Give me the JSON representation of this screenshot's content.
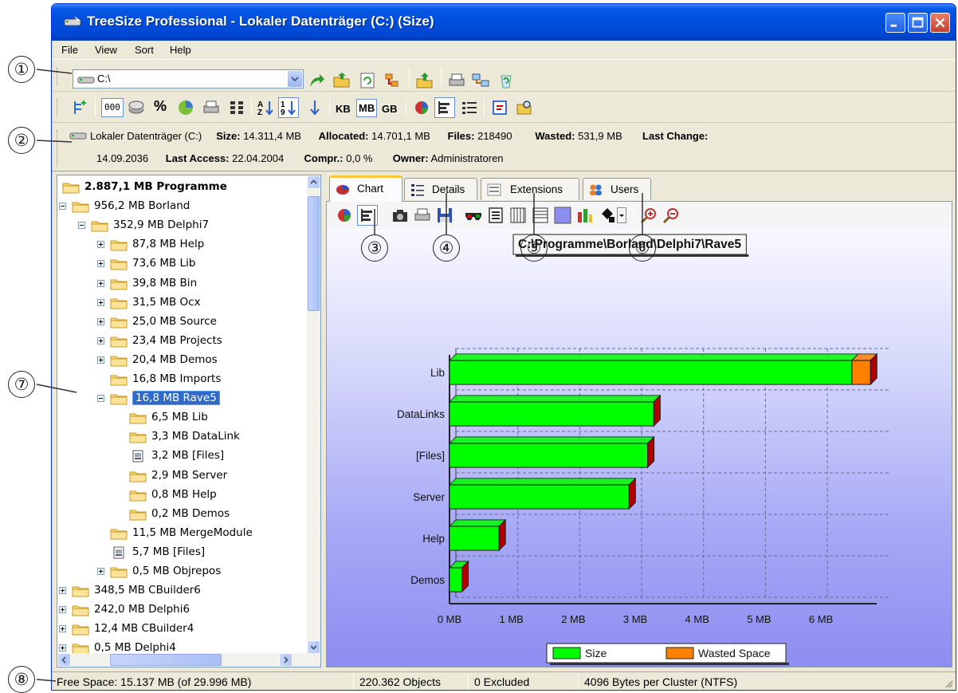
{
  "window": {
    "title": "TreeSize Professional - Lokaler Datenträger (C:)  (Size)",
    "controls": [
      "minimize",
      "maximize",
      "close"
    ]
  },
  "menu": [
    "File",
    "View",
    "Sort",
    "Help"
  ],
  "toolbar1": {
    "path_value": "C:\\",
    "icons": [
      "go-arrow-icon",
      "open-folder-icon",
      "refresh-icon",
      "scan-icon",
      "export-icon",
      "print-icon",
      "network-icon",
      "recycle-icon"
    ]
  },
  "toolbar2": {
    "icons": [
      "add-tree-icon",
      "size-mode-icon",
      "disk-icon",
      "percent-icon",
      "pie-mode-icon",
      "printer-icon",
      "grid-icon",
      "sort-az-icon",
      "sort-size-icon",
      "sort-down-icon",
      "pie-chart-icon",
      "bar-chart-icon",
      "list-icon",
      "report-icon",
      "search-icon"
    ],
    "size_box": "000",
    "percent": "%",
    "units": [
      "KB",
      "MB",
      "GB"
    ]
  },
  "info": {
    "drive": "Lokaler Datenträger (C:)",
    "size_label": "Size:",
    "size_value": "14.311,4 MB",
    "allocated_label": "Allocated:",
    "allocated_value": "14.701,1 MB",
    "files_label": "Files:",
    "files_value": "218490",
    "wasted_label": "Wasted:",
    "wasted_value": "531,9 MB",
    "lastchange_label": "Last Change:",
    "lastchange_value": "14.09.2036",
    "lastaccess_label": "Last Access:",
    "lastaccess_value": "22.04.2004",
    "compr_label": "Compr.:",
    "compr_value": "0,0 %",
    "owner_label": "Owner:",
    "owner_value": "Administratoren"
  },
  "tree": {
    "root": "2.887,1 MB Programme",
    "items": [
      {
        "text": "956,2 MB Borland"
      },
      {
        "text": "352,9 MB Delphi7"
      },
      {
        "text": "87,8 MB Help"
      },
      {
        "text": "73,6 MB Lib"
      },
      {
        "text": "39,8 MB Bin"
      },
      {
        "text": "31,5 MB Ocx"
      },
      {
        "text": "25,0 MB Source"
      },
      {
        "text": "23,4 MB Projects"
      },
      {
        "text": "20,4 MB Demos"
      },
      {
        "text": "16,8 MB Imports"
      },
      {
        "text": "16,8 MB Rave5"
      },
      {
        "text": "6,5 MB Lib"
      },
      {
        "text": "3,3 MB DataLink"
      },
      {
        "text": "3,2 MB [Files]"
      },
      {
        "text": "2,9 MB Server"
      },
      {
        "text": "0,8 MB Help"
      },
      {
        "text": "0,2 MB Demos"
      },
      {
        "text": "11,5 MB MergeModule"
      },
      {
        "text": "5,7 MB [Files]"
      },
      {
        "text": "0,5 MB Objrepos"
      },
      {
        "text": "348,5 MB CBuilder6"
      },
      {
        "text": "242,0 MB Delphi6"
      },
      {
        "text": "12,4 MB CBuilder4"
      },
      {
        "text": "0,5 MB Delphi4"
      }
    ]
  },
  "tabs": [
    {
      "label": "Chart",
      "icon": "pie-chart-icon"
    },
    {
      "label": "Details",
      "icon": "details-list-icon"
    },
    {
      "label": "Extensions",
      "icon": "extensions-icon"
    },
    {
      "label": "Users",
      "icon": "users-icon"
    }
  ],
  "chart_toolbar": {
    "icons": [
      "pie-chart-icon",
      "bar-chart-icon",
      "camera-icon",
      "print-icon",
      "save-icon",
      "3d-glasses-icon",
      "legend-icon",
      "vertical-grid-icon",
      "horizontal-grid-icon",
      "background-icon",
      "color-bars-icon",
      "fill-bucket-icon",
      "zoom-in-icon",
      "zoom-out-icon"
    ]
  },
  "chart_data": {
    "type": "bar",
    "orientation": "horizontal",
    "stacked": true,
    "title": "C:\\Programme\\Borland\\Delphi7\\Rave5",
    "categories": [
      "Lib",
      "DataLinks",
      "[Files]",
      "Server",
      "Help",
      "Demos"
    ],
    "series": [
      {
        "name": "Size",
        "color": "#00ff00",
        "values": [
          6.5,
          3.3,
          3.2,
          2.9,
          0.8,
          0.2
        ]
      },
      {
        "name": "Wasted Space",
        "color": "#ff8000",
        "values": [
          0.3,
          0.0,
          0.0,
          0.0,
          0.0,
          0.0
        ]
      }
    ],
    "x_ticks": [
      "0 MB",
      "1 MB",
      "2 MB",
      "3 MB",
      "4 MB",
      "5 MB",
      "6 MB"
    ],
    "xlim": [
      0,
      6.9
    ],
    "grid": true,
    "legend_position": "bottom-right",
    "colors": {
      "background_top": "#ffffff",
      "background_bottom": "#8c8df0",
      "side": "#b00000"
    }
  },
  "callouts": [
    "①",
    "②",
    "③",
    "④",
    "⑤",
    "⑥",
    "⑦",
    "⑧"
  ],
  "status": {
    "free_space": "Free Space: 15.137 MB  (of 29.996 MB)",
    "objects": "220.362 Objects",
    "excluded": "0 Excluded",
    "cluster": "4096 Bytes per Cluster (NTFS)"
  }
}
